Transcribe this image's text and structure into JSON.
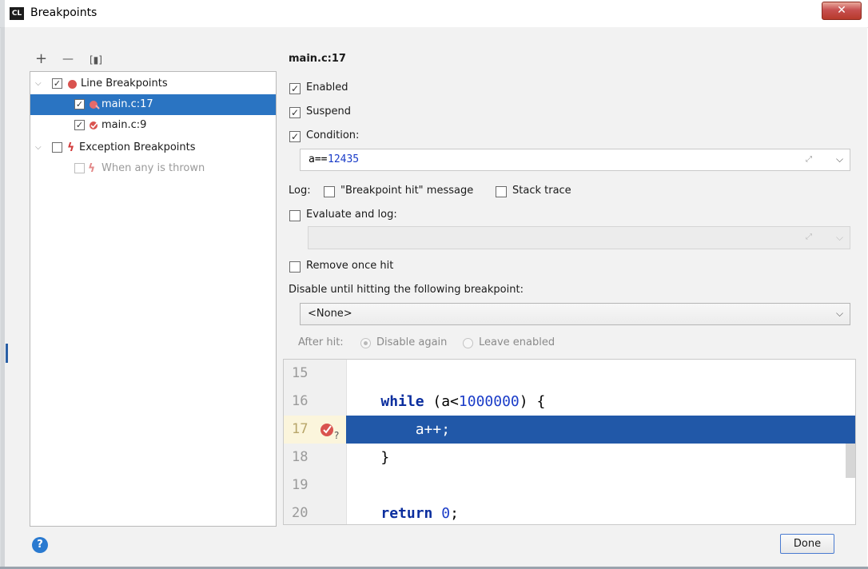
{
  "window": {
    "title": "Breakpoints",
    "app_icon_text": "CL",
    "close_label": "✕"
  },
  "toolbar": {
    "add_label": "+",
    "remove_label": "—",
    "group_label": "[▮]"
  },
  "tree": {
    "groups": [
      {
        "label": "Line Breakpoints",
        "checked": true,
        "items": [
          {
            "label": "main.c:17",
            "checked": true,
            "selected": true
          },
          {
            "label": "main.c:9",
            "checked": true,
            "selected": false
          }
        ]
      },
      {
        "label": "Exception Breakpoints",
        "checked": false,
        "items": [
          {
            "label": "When any is thrown",
            "checked": false,
            "disabled": true
          }
        ]
      }
    ]
  },
  "details": {
    "heading": "main.c:17",
    "enabled_label": "Enabled",
    "suspend_label": "Suspend",
    "condition_label": "Condition:",
    "condition_value_prefix": "a==",
    "condition_value_number": "12435",
    "log_label": "Log:",
    "log_message_label": "\"Breakpoint hit\" message",
    "log_stack_label": "Stack trace",
    "evaluate_label": "Evaluate and log:",
    "remove_once_label": "Remove once hit",
    "disable_until_label": "Disable until hitting the following breakpoint:",
    "disable_until_value": "<None>",
    "after_hit_label": "After hit:",
    "disable_again_label": "Disable again",
    "leave_enabled_label": "Leave enabled"
  },
  "editor": {
    "line_numbers": [
      "15",
      "16",
      "17",
      "18",
      "19",
      "20"
    ],
    "line16": {
      "kw": "while",
      "mid": " (a<",
      "num": "1000000",
      "tail": ") {"
    },
    "line17": "a++;",
    "line18": "}",
    "line20": {
      "kw": "return",
      "sp": " ",
      "num": "0",
      "tail": ";"
    }
  },
  "footer": {
    "help_label": "?",
    "done_label": "Done"
  },
  "colors": {
    "selection": "#2a74c2",
    "editor_highlight": "#2158a8",
    "breakpoint_red": "#d9534f",
    "keyword": "#0b2e9e"
  }
}
